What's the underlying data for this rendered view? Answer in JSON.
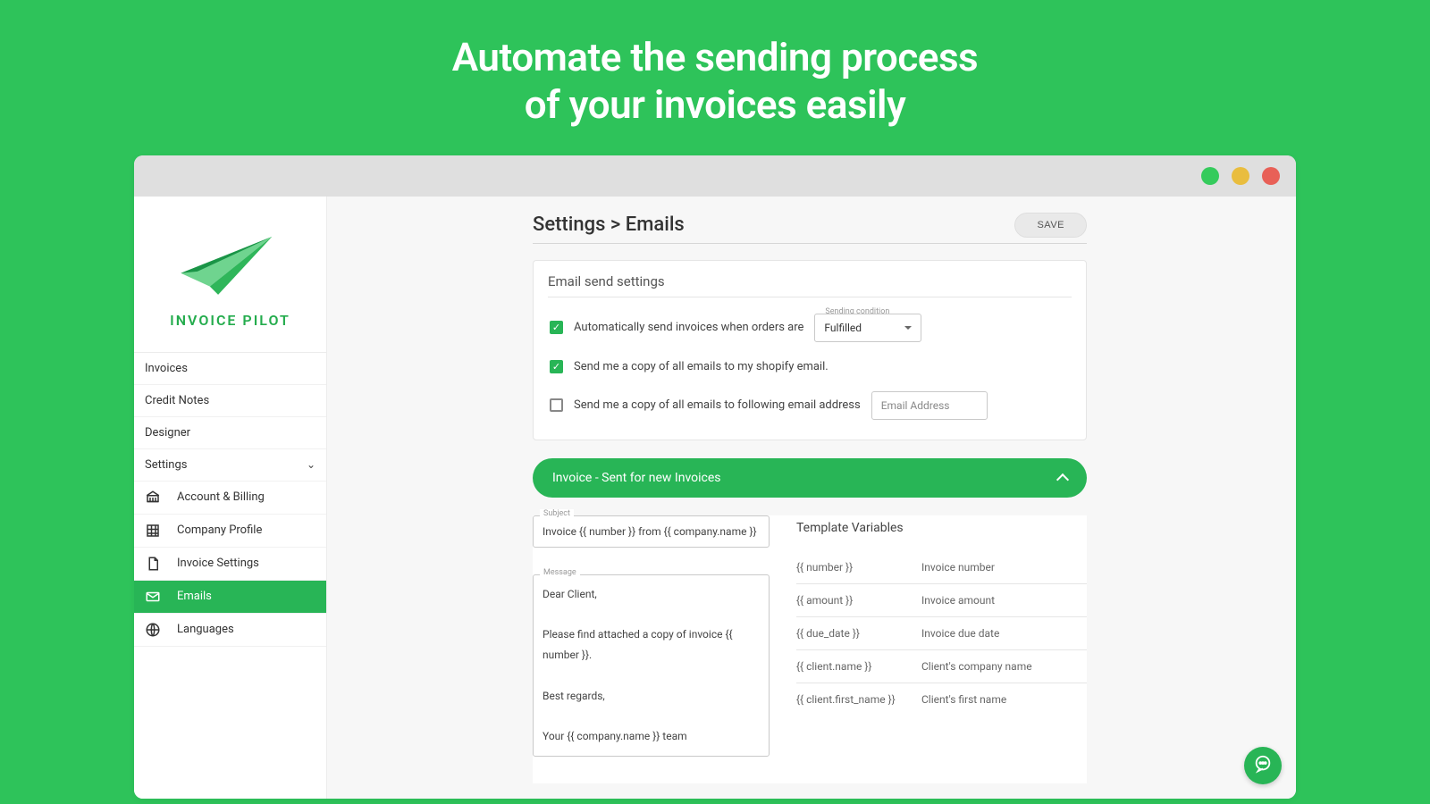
{
  "hero": {
    "line1": "Automate the sending process",
    "line2": "of your invoices easily"
  },
  "brand": {
    "name": "INVOICE PILOT"
  },
  "nav": {
    "invoices": "Invoices",
    "credit_notes": "Credit Notes",
    "designer": "Designer",
    "settings": "Settings",
    "sub": {
      "account": "Account & Billing",
      "company": "Company Profile",
      "invoice_settings": "Invoice Settings",
      "emails": "Emails",
      "languages": "Languages"
    }
  },
  "page": {
    "breadcrumb": "Settings > Emails",
    "save": "SAVE"
  },
  "card1": {
    "title": "Email send settings",
    "row1": "Automatically send invoices when orders are",
    "condition_label": "Sending condition",
    "condition_value": "Fulfilled",
    "row2": "Send me a copy of all emails to my shopify email.",
    "row3": "Send me a copy of all emails to following email address",
    "placeholder": "Email Address"
  },
  "accordion": {
    "title": "Invoice - Sent for new Invoices",
    "subject_label": "Subject",
    "subject_value": "Invoice {{ number }} from {{ company.name }}",
    "message_label": "Message",
    "message_value": "Dear Client,\n\nPlease find attached a copy of invoice {{ number }}.\n\nBest regards,\n\nYour {{ company.name }} team",
    "tv_title": "Template Variables",
    "vars": [
      {
        "k": "{{ number }}",
        "v": "Invoice number"
      },
      {
        "k": "{{ amount }}",
        "v": "Invoice amount"
      },
      {
        "k": "{{ due_date }}",
        "v": "Invoice due date"
      },
      {
        "k": "{{ client.name }}",
        "v": "Client's company name"
      },
      {
        "k": "{{ client.first_name }}",
        "v": "Client's first name"
      }
    ]
  }
}
